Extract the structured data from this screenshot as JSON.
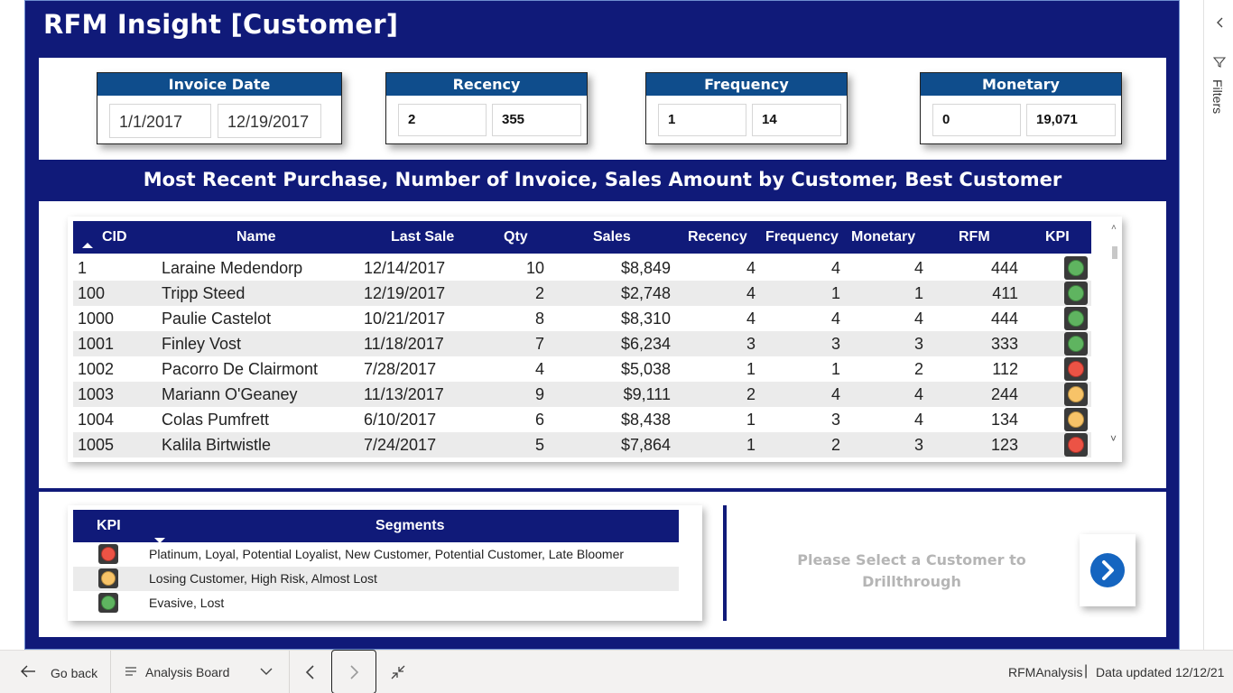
{
  "report": {
    "title": "RFM Insight [Customer]",
    "section_title": "Most Recent Purchase, Number of Invoice, Sales Amount by Customer, Best Customer"
  },
  "filters": {
    "invoice_date": {
      "label": "Invoice Date",
      "from": "1/1/2017",
      "to": "12/19/2017"
    },
    "recency": {
      "label": "Recency",
      "from": "2",
      "to": "355"
    },
    "frequency": {
      "label": "Frequency",
      "from": "1",
      "to": "14"
    },
    "monetary": {
      "label": "Monetary",
      "from": "0",
      "to": "19,071"
    }
  },
  "table": {
    "headers": [
      "CID",
      "Name",
      "Last Sale",
      "Qty",
      "Sales",
      "Recency",
      "Frequency",
      "Monetary",
      "RFM",
      "KPI"
    ],
    "sort": "CID ascending",
    "rows": [
      [
        "1",
        "Laraine Medendorp",
        "12/14/2017",
        "10",
        "$8,849",
        "4",
        "4",
        "4",
        "444",
        "green"
      ],
      [
        "100",
        "Tripp Steed",
        "12/19/2017",
        "2",
        "$2,748",
        "4",
        "1",
        "1",
        "411",
        "green"
      ],
      [
        "1000",
        "Paulie Castelot",
        "10/21/2017",
        "8",
        "$8,310",
        "4",
        "4",
        "4",
        "444",
        "green"
      ],
      [
        "1001",
        "Finley Vost",
        "11/18/2017",
        "7",
        "$6,234",
        "3",
        "3",
        "3",
        "333",
        "green"
      ],
      [
        "1002",
        "Pacorro De Clairmont",
        "7/28/2017",
        "4",
        "$5,038",
        "1",
        "1",
        "2",
        "112",
        "red"
      ],
      [
        "1003",
        "Mariann O'Geaney",
        "11/13/2017",
        "9",
        "$9,111",
        "2",
        "4",
        "4",
        "244",
        "amber"
      ],
      [
        "1004",
        "Colas Pumfrett",
        "6/10/2017",
        "6",
        "$8,438",
        "1",
        "3",
        "4",
        "134",
        "amber"
      ],
      [
        "1005",
        "Kalila Birtwistle",
        "7/24/2017",
        "5",
        "$7,864",
        "1",
        "2",
        "3",
        "123",
        "red"
      ]
    ]
  },
  "legend": {
    "headers": [
      "KPI",
      "Segments"
    ],
    "rows": [
      {
        "kpi": "red",
        "segments": "Platinum, Loyal, Potential Loyalist, New Customer, Potential Customer, Late Bloomer"
      },
      {
        "kpi": "amber",
        "segments": "Losing Customer, High Risk, Almost Lost"
      },
      {
        "kpi": "green",
        "segments": "Evasive, Lost"
      }
    ]
  },
  "drillthrough": {
    "message_line1": "Please Select a Customer to",
    "message_line2": "Drillthrough"
  },
  "filters_pane": {
    "label": "Filters"
  },
  "bottom_bar": {
    "go_back": "Go back",
    "page_name": "Analysis Board",
    "dataset": "RFMAnalysis",
    "separator": "|",
    "updated": "Data updated 12/12/21"
  },
  "colors": {
    "navy": "#101a79",
    "filter_header": "#0f4d8c",
    "kpi_green": "#5fb460",
    "kpi_red": "#ec5345",
    "kpi_amber": "#f7c368",
    "drill_button": "#1565c0"
  },
  "icons": {
    "filters_collapse": "chevron-left-icon",
    "filters_funnel": "funnel-icon",
    "go_back": "arrow-left-icon",
    "page_list": "hamburger-icon",
    "page_dropdown": "chevron-down-icon",
    "prev_page": "chevron-left-icon",
    "next_page": "chevron-right-icon",
    "fit_page": "collapse-arrows-icon",
    "drillthrough": "chevron-right-circle-icon"
  }
}
